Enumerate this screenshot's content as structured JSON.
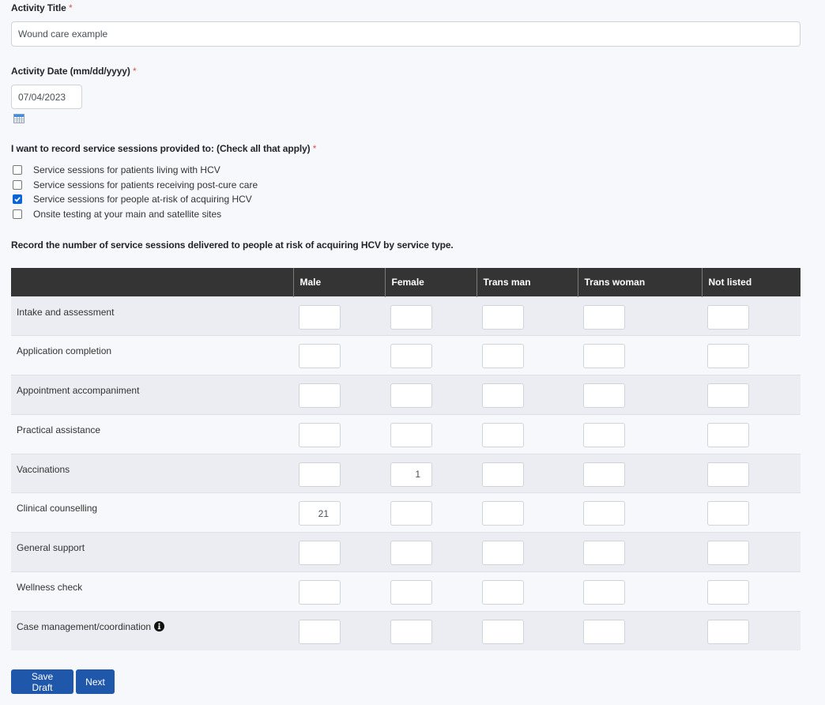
{
  "title_field": {
    "label": "Activity Title",
    "required_mark": "*",
    "value": "Wound care example"
  },
  "date_field": {
    "label": "Activity Date (mm/dd/yyyy)",
    "required_mark": "*",
    "value": "07/04/2023",
    "calendar_icon": "calendar-icon"
  },
  "services": {
    "label": "I want to record service sessions provided to: (Check all that apply)",
    "required_mark": "*",
    "options": [
      {
        "label": "Service sessions for patients living with HCV",
        "checked": false
      },
      {
        "label": "Service sessions for patients receiving post-cure care",
        "checked": false
      },
      {
        "label": "Service sessions for people at-risk of acquiring HCV",
        "checked": true
      },
      {
        "label": "Onsite testing at your main and satellite sites",
        "checked": false
      }
    ]
  },
  "grid": {
    "instruction": "Record the number of service sessions delivered to people at risk of acquiring HCV by service type.",
    "columns": [
      "",
      "Male",
      "Female",
      "Trans man",
      "Trans woman",
      "Not listed"
    ],
    "rows": [
      {
        "label": "Intake and assessment",
        "values": [
          "",
          "",
          "",
          "",
          ""
        ]
      },
      {
        "label": "Application completion",
        "values": [
          "",
          "",
          "",
          "",
          ""
        ]
      },
      {
        "label": "Appointment accompaniment",
        "values": [
          "",
          "",
          "",
          "",
          ""
        ]
      },
      {
        "label": "Practical assistance",
        "values": [
          "",
          "",
          "",
          "",
          ""
        ]
      },
      {
        "label": "Vaccinations",
        "values": [
          "",
          "1",
          "",
          "",
          ""
        ]
      },
      {
        "label": "Clinical counselling",
        "values": [
          "21",
          "",
          "",
          "",
          ""
        ]
      },
      {
        "label": "General support",
        "values": [
          "",
          "",
          "",
          "",
          ""
        ]
      },
      {
        "label": "Wellness check",
        "values": [
          "",
          "",
          "",
          "",
          ""
        ]
      },
      {
        "label": "Case management/coordination",
        "values": [
          "",
          "",
          "",
          "",
          ""
        ],
        "info_icon": "info-circle-icon"
      }
    ]
  },
  "buttons": {
    "save_draft": "Save Draft",
    "next": "Next"
  },
  "colors": {
    "primary": "#1f58ab",
    "header_bg": "#343434",
    "required": "#d9534f",
    "checkbox_checked": "#0a64d8"
  }
}
